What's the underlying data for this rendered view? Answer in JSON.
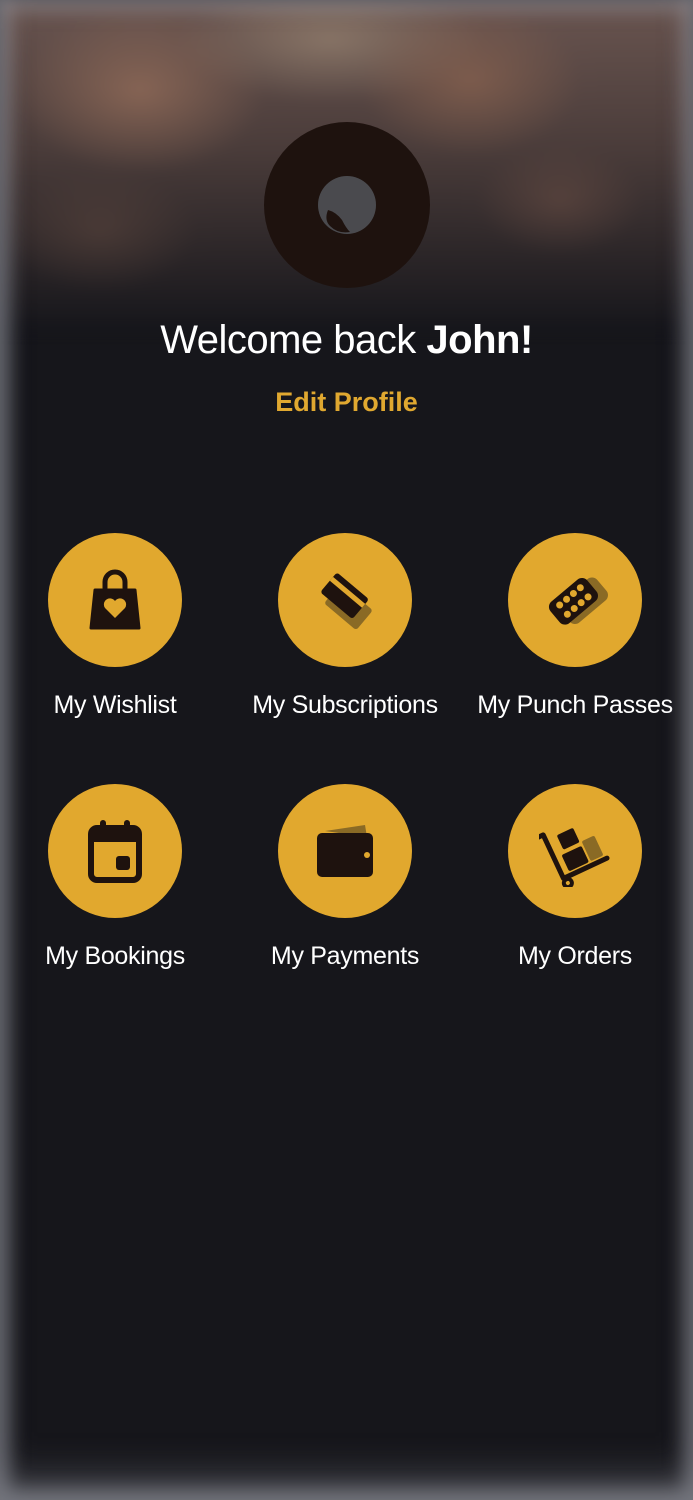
{
  "profile": {
    "welcome_prefix": "Welcome back ",
    "user_name": "John!",
    "edit_profile_label": "Edit Profile",
    "avatar_icon": "user-avatar-icon"
  },
  "menu": {
    "items": [
      {
        "label": "My Wishlist",
        "icon": "shopping-bag-heart-icon"
      },
      {
        "label": "My Subscriptions",
        "icon": "cards-icon"
      },
      {
        "label": "My Punch Passes",
        "icon": "punch-card-icon"
      },
      {
        "label": "My Bookings",
        "icon": "calendar-icon"
      },
      {
        "label": "My Payments",
        "icon": "wallet-icon"
      },
      {
        "label": "My Orders",
        "icon": "hand-truck-icon"
      }
    ]
  },
  "colors": {
    "accent": "#e1a82e",
    "background": "#16161b",
    "icon_dark": "#1e120e",
    "text": "#ffffff"
  }
}
